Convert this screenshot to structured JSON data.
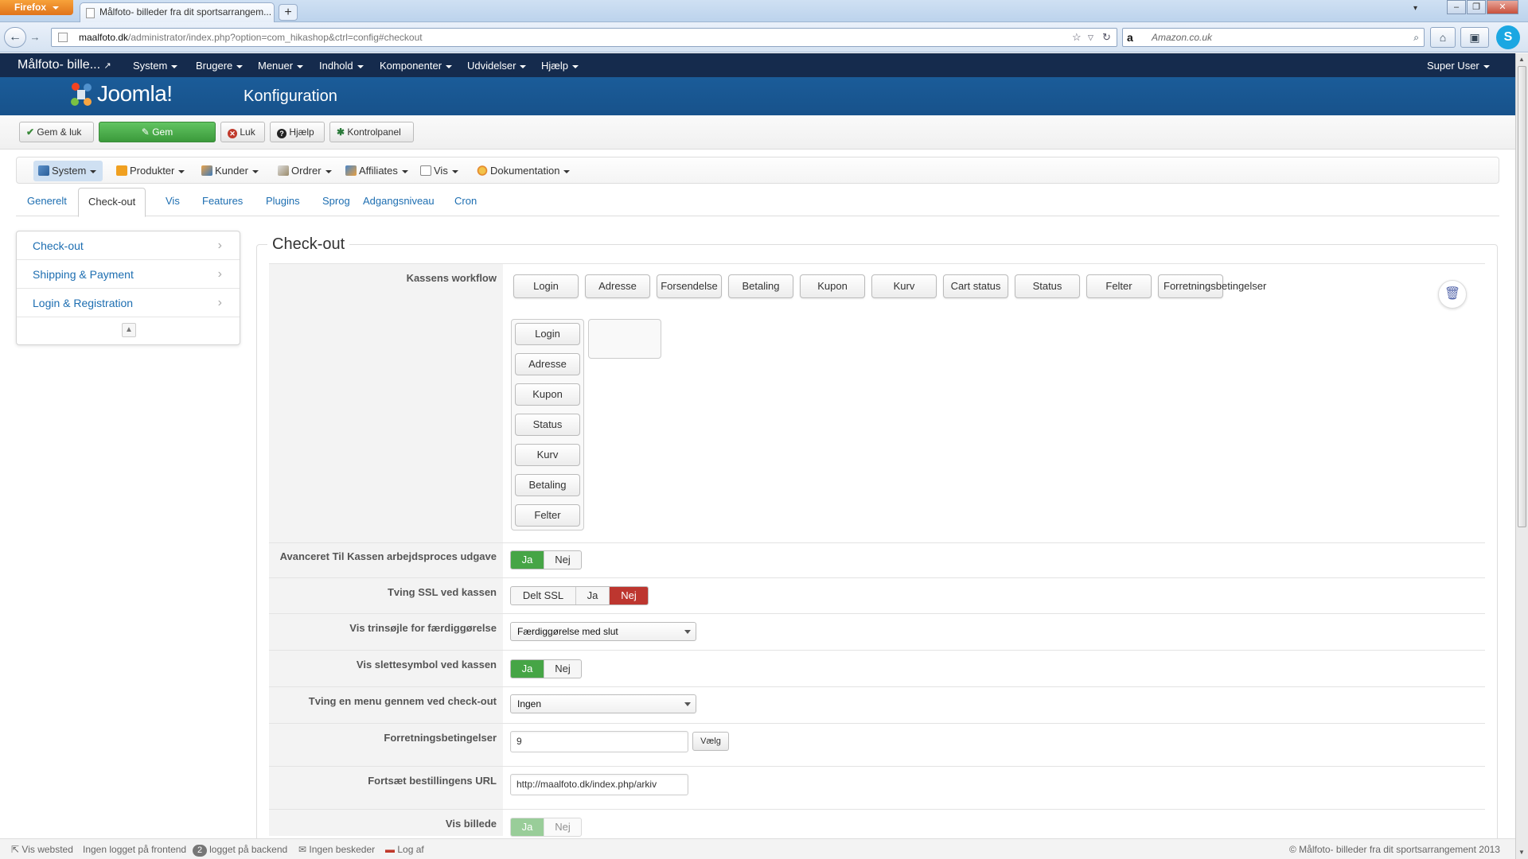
{
  "browser": {
    "firefox_label": "Firefox",
    "tab_title": "Målfoto- billeder fra dit sportsarrangem...",
    "new_tab": "+",
    "url_domain": "maalfoto.dk",
    "url_path": "/administrator/index.php?option=com_hikashop&ctrl=config#checkout",
    "search_placeholder": "Amazon.co.uk"
  },
  "admin_menu": {
    "site_name": "Målfoto- bille...",
    "items": [
      "System",
      "Brugere",
      "Menuer",
      "Indhold",
      "Komponenter",
      "Udvidelser",
      "Hjælp"
    ],
    "user": "Super User"
  },
  "header": {
    "logo_text": "Joomla!",
    "title": "Konfiguration"
  },
  "toolbar": {
    "save_close": "Gem & luk",
    "save": "Gem",
    "close": "Luk",
    "help": "Hjælp",
    "control_panel": "Kontrolpanel"
  },
  "hikashop_menu": [
    "System",
    "Produkter",
    "Kunder",
    "Ordrer",
    "Affiliates",
    "Vis",
    "Dokumentation"
  ],
  "tabs": [
    "Generelt",
    "Check-out",
    "Vis",
    "Features",
    "Plugins",
    "Sprog",
    "Adgangsniveau",
    "Cron"
  ],
  "sidenav": [
    "Check-out",
    "Shipping & Payment",
    "Login & Registration"
  ],
  "section": {
    "title": "Check-out",
    "workflow_label": "Kassens workflow",
    "workflow_buttons": [
      "Login",
      "Adresse",
      "Forsendelse",
      "Betaling",
      "Kupon",
      "Kurv",
      "Cart status",
      "Status",
      "Felter",
      "Forretningsbetingelser"
    ],
    "workflow_stack": [
      "Login",
      "Adresse",
      "Kupon",
      "Status",
      "Kurv",
      "Betaling",
      "Felter"
    ],
    "advanced_label": "Avanceret Til Kassen arbejdsproces udgave",
    "ssl_label": "Tving SSL ved kassen",
    "steps_label": "Vis trinsøjle for færdiggørelse",
    "steps_value": "Færdiggørelse med slut",
    "delete_label": "Vis slettesymbol ved kassen",
    "force_menu_label": "Tving en menu gennem ved check-out",
    "force_menu_value": "Ingen",
    "terms_label": "Forretningsbetingelser",
    "terms_value": "9",
    "terms_button": "Vælg",
    "continue_label": "Fortsæt bestillingens URL",
    "continue_value": "http://maalfoto.dk/index.php/arkiv",
    "image_label": "Vis billede",
    "yes": "Ja",
    "no": "Nej",
    "shared_ssl": "Delt SSL"
  },
  "statusbar": {
    "view_site": "Vis websted",
    "frontend": "Ingen logget på frontend",
    "backend_count": "2",
    "backend": "logget på backend",
    "messages": "Ingen beskeder",
    "logout": "Log af",
    "copyright": "© Målfoto- billeder fra dit sportsarrangement 2013"
  },
  "colors": {
    "admin_menu_bg": "#152b4d",
    "header_bg": "#1b5c99",
    "green": "#46a546",
    "red": "#bd362f",
    "link": "#1d6eb1"
  }
}
